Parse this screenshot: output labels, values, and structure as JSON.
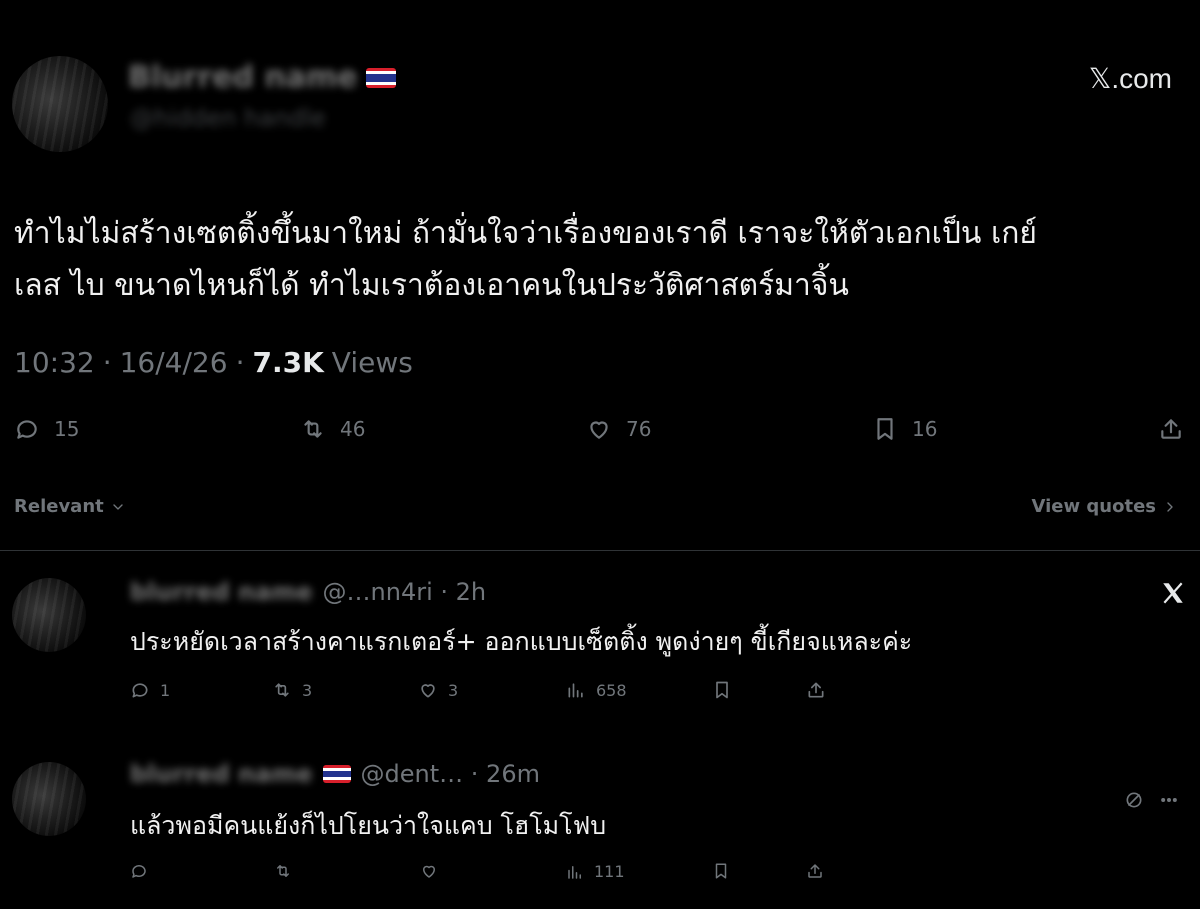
{
  "brand": {
    "watermark": "𝕏.com"
  },
  "tweet": {
    "author_name": "Blurred name",
    "author_handle": "@hidden handle",
    "text_line1": "ทำไมไม่สร้างเซตติ้งขึ้นมาใหม่ ถ้ามั่นใจว่าเรื่องของเราดี เราจะให้ตัวเอกเป็น เกย์",
    "text_line2": "เลส ไบ ขนาดไหนก็ได้ ทำไมเราต้องเอาคนในประวัติศาสตร์มาจิ้น",
    "time": "10:32",
    "date": "16/4/26",
    "sep": "·",
    "views_count": "7.3K",
    "views_label": "Views",
    "actions": {
      "replies": "15",
      "reposts": "46",
      "likes": "76",
      "bookmarks": "16"
    },
    "icons": [
      "reply-icon",
      "repost-icon",
      "like-icon",
      "bookmark-icon",
      "share-icon"
    ]
  },
  "filters": {
    "sort_label": "Relevant",
    "view_quotes_label": "View quotes"
  },
  "replies": [
    {
      "name": "blurred name",
      "handle_meta": "@…nn4ri · 2h",
      "text": "ประหยัดเวลาสร้างคาแรกเตอร์+ ออกแบบเซ็ตติ้ง พูดง่ายๆ ขี้เกียจแหละค่ะ",
      "replies": "1",
      "reposts": "3",
      "likes": "3",
      "views": "658",
      "corner_icon": "x-logo-icon"
    },
    {
      "name": "blurred name",
      "handle_meta": "@dent… · 26m",
      "text": "แล้วพอมีคนแย้งก็ไปโยนว่าใจแคบ โฮโมโฟบ",
      "replies": "",
      "reposts": "",
      "likes": "",
      "views": "111",
      "corner_icon": "no-entry-icon"
    }
  ],
  "colors": {
    "background": "#000000",
    "text": "#e7e9ea",
    "muted": "#71767b",
    "divider": "#2f3336"
  }
}
